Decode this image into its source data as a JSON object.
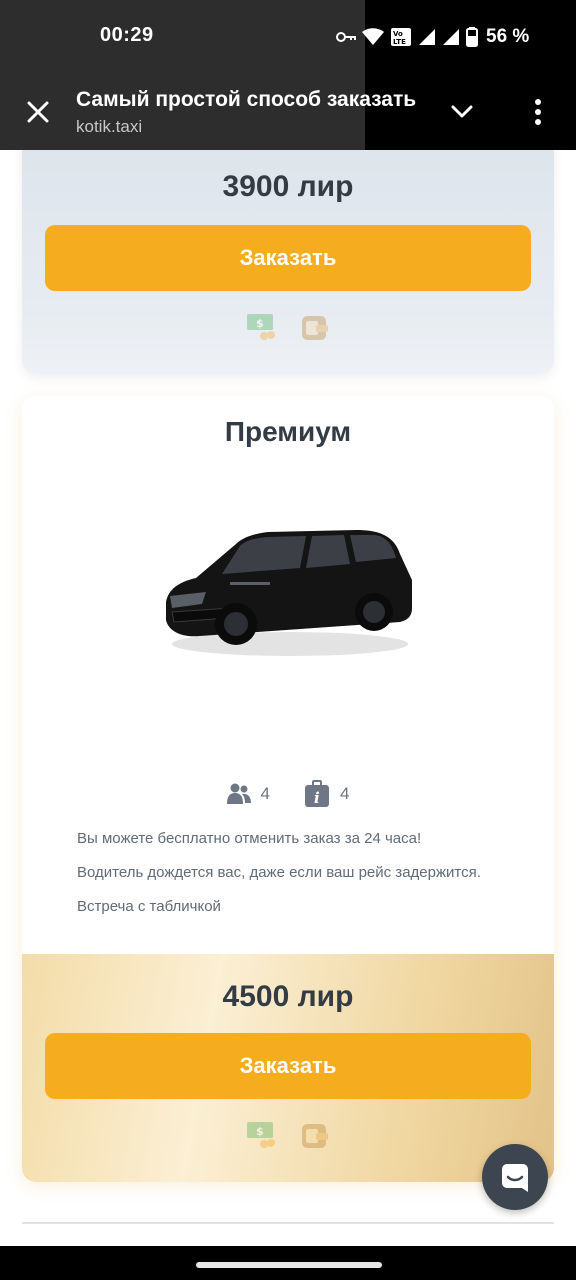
{
  "status_bar": {
    "time": "00:29",
    "battery": "56 %",
    "icons": [
      "key-icon",
      "wifi-icon",
      "volte-icon",
      "signal-icon",
      "signal-icon",
      "battery-icon"
    ]
  },
  "browser": {
    "title": "Самый простой способ заказать",
    "url": "kotik.taxi",
    "icons": [
      "close-icon",
      "chevron-down-icon",
      "more-vert-icon"
    ]
  },
  "cards": {
    "previous": {
      "price": "3900 лир",
      "order_label": "Заказать",
      "payment_icons": [
        "cash-icon",
        "card-wallet-icon"
      ]
    },
    "premium": {
      "title": "Премиум",
      "image": "black-minivan-image",
      "passengers": "4",
      "luggage": "4",
      "features": [
        "Вы можете бесплатно отменить заказ за 24 часа!",
        "Водитель дождется вас, даже если ваш рейс задержится.",
        "Встреча с табличкой"
      ],
      "price": "4500 лир",
      "order_label": "Заказать",
      "payment_icons": [
        "cash-icon",
        "card-wallet-icon"
      ]
    }
  },
  "colors": {
    "accent": "#f6ac1f",
    "text_dark": "#333b44",
    "chat_button": "#3d4550"
  }
}
